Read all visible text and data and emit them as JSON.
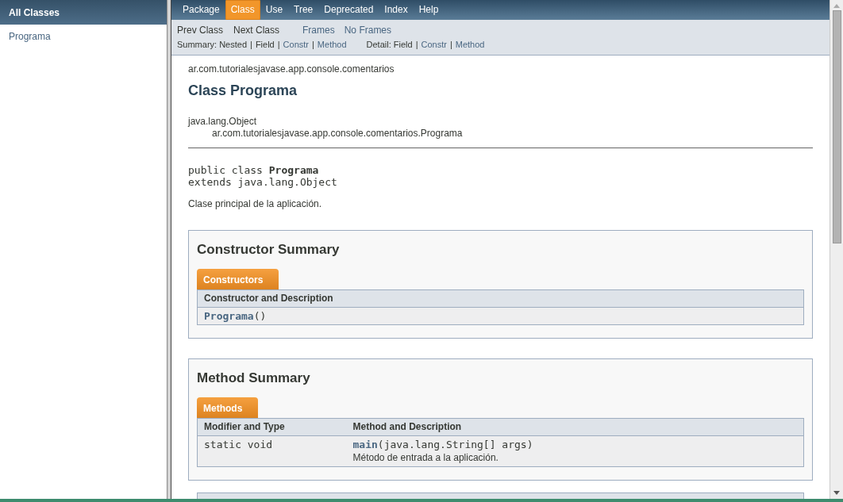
{
  "left_frame": {
    "title": "All Classes",
    "classes": [
      {
        "label": "Programa"
      }
    ]
  },
  "top_nav": [
    {
      "label": "Package",
      "selected": false
    },
    {
      "label": "Class",
      "selected": true
    },
    {
      "label": "Use",
      "selected": false
    },
    {
      "label": "Tree",
      "selected": false
    },
    {
      "label": "Deprecated",
      "selected": false
    },
    {
      "label": "Index",
      "selected": false
    },
    {
      "label": "Help",
      "selected": false
    }
  ],
  "sub_nav": {
    "class_links": [
      {
        "label": "Prev Class",
        "kind": "text"
      },
      {
        "label": "Next Class",
        "kind": "text"
      }
    ],
    "frame_links": [
      {
        "label": "Frames",
        "kind": "link"
      },
      {
        "label": "No Frames",
        "kind": "link"
      }
    ],
    "summary": [
      {
        "label": "Summary: Nested",
        "kind": "text"
      },
      {
        "label": "|",
        "kind": "separator"
      },
      {
        "label": "Field",
        "kind": "text"
      },
      {
        "label": "|",
        "kind": "separator"
      },
      {
        "label": "Constr",
        "kind": "link"
      },
      {
        "label": "|",
        "kind": "separator"
      },
      {
        "label": "Method",
        "kind": "link"
      }
    ],
    "detail": [
      {
        "label": "Detail: Field",
        "kind": "text"
      },
      {
        "label": "|",
        "kind": "separator"
      },
      {
        "label": "Constr",
        "kind": "link"
      },
      {
        "label": "|",
        "kind": "separator"
      },
      {
        "label": "Method",
        "kind": "link"
      }
    ]
  },
  "package": "ar.com.tutorialesjavase.app.console.comentarios",
  "title": "Class Programa",
  "inheritance": {
    "label": "java.lang.Object",
    "children": [
      {
        "label": "ar.com.tutorialesjavase.app.console.comentarios.Programa"
      }
    ]
  },
  "signature": [
    "public class **Programa**",
    "extends java.lang.Object"
  ],
  "description": "Clase principal de la aplicación.",
  "sections": [
    {
      "title": "Constructor Summary",
      "tab": "Constructors",
      "columns": [
        "Constructor and Description"
      ],
      "rows": [
        {
          "cells": [
            {
              "link": "Programa",
              "code": "()"
            }
          ]
        }
      ]
    },
    {
      "title": "Method Summary",
      "tab": "Methods",
      "columns": [
        "Modifier and Type",
        "Method and Description"
      ],
      "rows": [
        {
          "cells": [
            {
              "code": "static void"
            },
            {
              "link": "main",
              "code": "(java.lang.String[] args)",
              "description": "Método de entrada a la aplicación."
            }
          ]
        }
      ]
    }
  ]
}
